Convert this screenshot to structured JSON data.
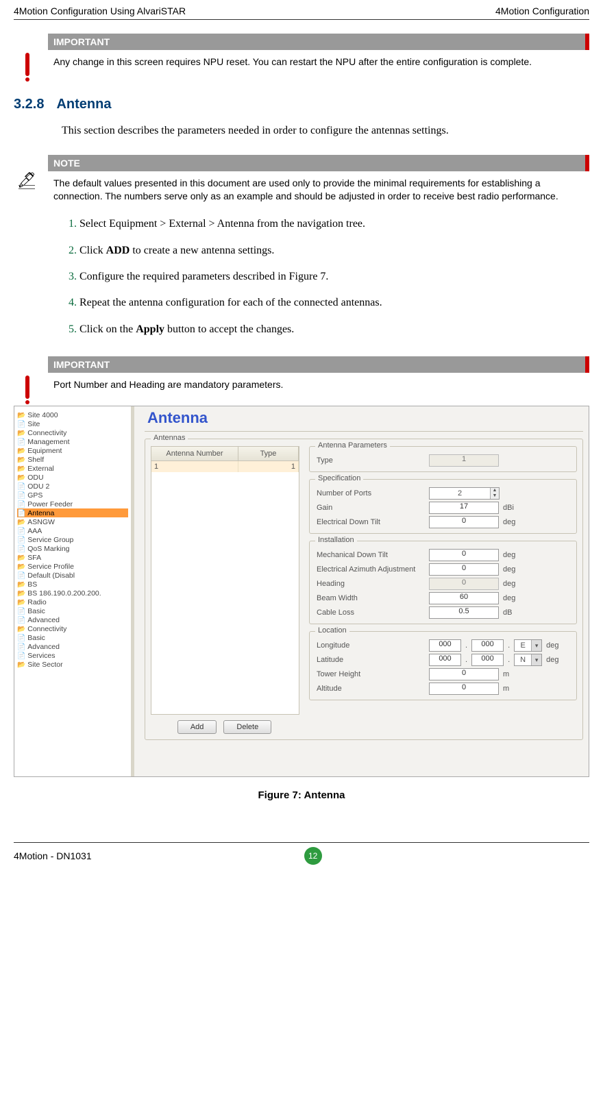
{
  "header": {
    "left": "4Motion Configuration Using AlvariSTAR",
    "right": "4Motion Configuration"
  },
  "callout1": {
    "title": "IMPORTANT",
    "text": "Any change in this screen requires NPU reset. You can restart the NPU after the entire configuration is complete."
  },
  "section": {
    "num": "3.2.8",
    "title": "Antenna",
    "intro": "This section describes the parameters needed in order to configure the antennas settings."
  },
  "note": {
    "title": "NOTE",
    "text": "The default values presented in this document are used only to provide the minimal requirements for establishing a connection. The numbers serve only as an example and should be adjusted in order to receive best radio performance."
  },
  "steps": {
    "s1": "Select Equipment > External > Antenna from the navigation tree.",
    "s2_a": "Click ",
    "s2_b": "ADD",
    "s2_c": " to create a new antenna settings.",
    "s3": "Configure the required parameters described in Figure 7.",
    "s4": "Repeat the antenna configuration for each of the connected antennas.",
    "s5_a": "Click on the ",
    "s5_b": "Apply",
    "s5_c": " button to accept the changes."
  },
  "callout2": {
    "title": "IMPORTANT",
    "text": "Port Number and Heading are mandatory parameters."
  },
  "figure": {
    "caption": "Figure 7: Antenna",
    "tree": {
      "n0": "Site 4000",
      "n1": "Site",
      "n2": "Connectivity",
      "n3": "Management",
      "n4": "Equipment",
      "n5": "Shelf",
      "n6": "External",
      "n7": "ODU",
      "n8": "ODU 2",
      "n9": "GPS",
      "n10": "Power Feeder",
      "n11": "Antenna",
      "n12": "ASNGW",
      "n13": "AAA",
      "n14": "Service Group",
      "n15": "QoS Marking",
      "n16": "SFA",
      "n17": "Service Profile",
      "n18": "Default (Disabl",
      "n19": "BS",
      "n20": "BS 186.190.0.200.200.",
      "n21": "Radio",
      "n22": "Basic",
      "n23": "Advanced",
      "n24": "Connectivity",
      "n25": "Basic",
      "n26": "Advanced",
      "n27": "Services",
      "n28": "Site Sector"
    },
    "mainTitle": "Antenna",
    "listLegend": "Antennas",
    "gridHead": {
      "c1": "Antenna Number",
      "c2": "Type"
    },
    "gridRow": {
      "c1": "1",
      "c2": "1"
    },
    "buttons": {
      "add": "Add",
      "delete": "Delete"
    },
    "groups": {
      "params": "Antenna Parameters",
      "spec": "Specification",
      "install": "Installation",
      "location": "Location"
    },
    "labels": {
      "type": "Type",
      "numPorts": "Number of Ports",
      "gain": "Gain",
      "edt": "Electrical Down Tilt",
      "mdt": "Mechanical Down Tilt",
      "eaa": "Electrical Azimuth Adjustment",
      "heading": "Heading",
      "beam": "Beam Width",
      "cable": "Cable Loss",
      "lon": "Longitude",
      "lat": "Latitude",
      "tower": "Tower Height",
      "alt": "Altitude"
    },
    "values": {
      "type": "1",
      "numPorts": "2",
      "gain": "17",
      "edt": "0",
      "mdt": "0",
      "eaa": "0",
      "heading": "0",
      "beam": "60",
      "cable": "0.5",
      "lon1": "000",
      "lon2": "000",
      "lonDir": "E",
      "lat1": "000",
      "lat2": "000",
      "latDir": "N",
      "tower": "0",
      "alt": "0"
    },
    "units": {
      "dbi": "dBi",
      "deg": "deg",
      "db": "dB",
      "m": "m"
    }
  },
  "footer": {
    "doc": "4Motion - DN1031",
    "page": "12"
  }
}
